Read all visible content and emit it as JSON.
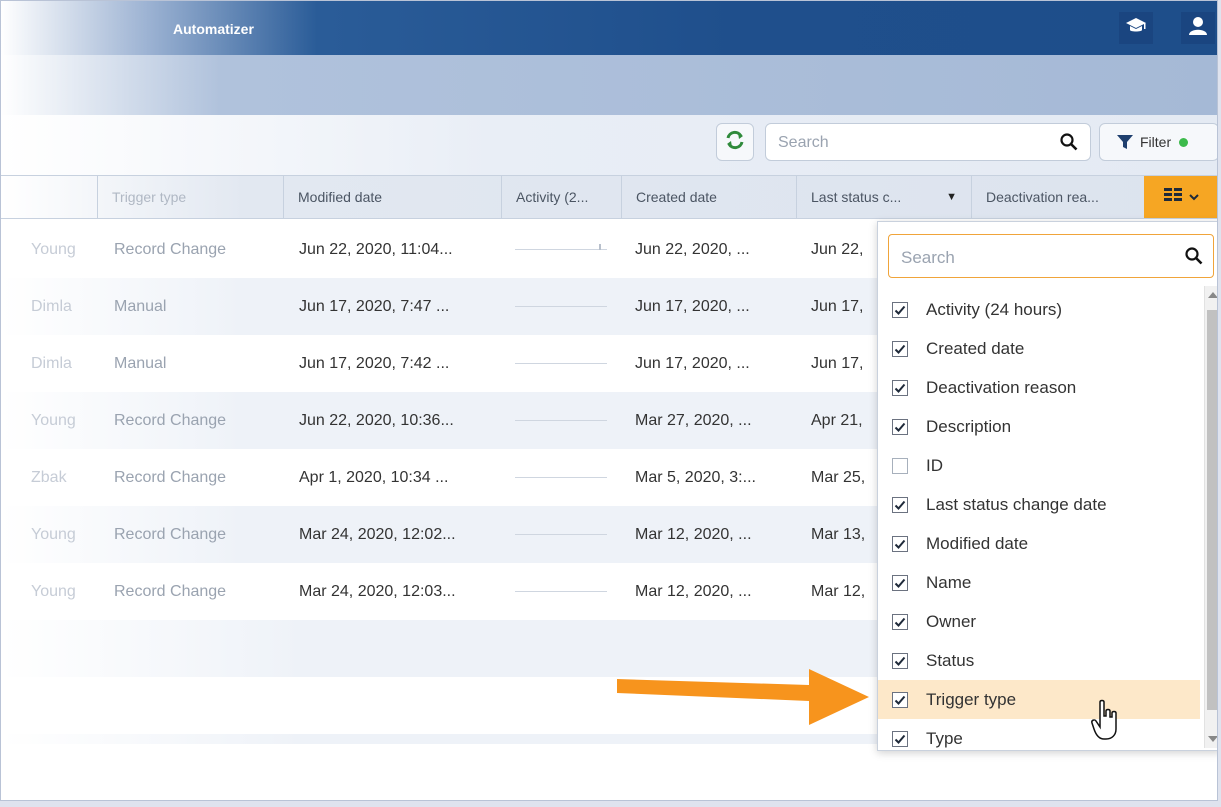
{
  "app": {
    "title": "Automatizer"
  },
  "toolbar": {
    "search_placeholder": "Search",
    "filter_label": "Filter",
    "filter_status_color": "#3cba4b"
  },
  "colors": {
    "header_blue": "#1f4f8c",
    "accent_orange": "#f6a623",
    "highlight": "#fde8c9"
  },
  "table": {
    "headers": {
      "trigger_type": "Trigger type",
      "modified_date": "Modified date",
      "activity": "Activity (2...",
      "created_date": "Created date",
      "last_status": "Last status c...",
      "deactivation": "Deactivation rea..."
    },
    "rows": [
      {
        "owner": "Young",
        "trigger": "Record Change",
        "modified": "Jun 22, 2020, 11:04...",
        "created": "Jun 22, 2020, ...",
        "last": "Jun 22,"
      },
      {
        "owner": "Dimla",
        "trigger": "Manual",
        "modified": "Jun 17, 2020, 7:47 ...",
        "created": "Jun 17, 2020, ...",
        "last": "Jun 17,"
      },
      {
        "owner": "Dimla",
        "trigger": "Manual",
        "modified": "Jun 17, 2020, 7:42 ...",
        "created": "Jun 17, 2020, ...",
        "last": "Jun 17,"
      },
      {
        "owner": "Young",
        "trigger": "Record Change",
        "modified": "Jun 22, 2020, 10:36...",
        "created": "Mar 27, 2020, ...",
        "last": "Apr 21,"
      },
      {
        "owner": "Zbak",
        "trigger": "Record Change",
        "modified": "Apr 1, 2020, 10:34 ...",
        "created": "Mar 5, 2020, 3:...",
        "last": "Mar 25,"
      },
      {
        "owner": "Young",
        "trigger": "Record Change",
        "modified": "Mar 24, 2020, 12:02...",
        "created": "Mar 12, 2020, ...",
        "last": "Mar 13,"
      },
      {
        "owner": "Young",
        "trigger": "Record Change",
        "modified": "Mar 24, 2020, 12:03...",
        "created": "Mar 12, 2020, ...",
        "last": "Mar 12,"
      }
    ]
  },
  "column_picker": {
    "search_placeholder": "Search",
    "items": [
      {
        "label": "Activity (24 hours)",
        "checked": true
      },
      {
        "label": "Created date",
        "checked": true
      },
      {
        "label": "Deactivation reason",
        "checked": true
      },
      {
        "label": "Description",
        "checked": true
      },
      {
        "label": "ID",
        "checked": false
      },
      {
        "label": "Last status change date",
        "checked": true
      },
      {
        "label": "Modified date",
        "checked": true
      },
      {
        "label": "Name",
        "checked": true
      },
      {
        "label": "Owner",
        "checked": true
      },
      {
        "label": "Status",
        "checked": true
      },
      {
        "label": "Trigger type",
        "checked": true,
        "highlighted": true
      },
      {
        "label": "Type",
        "checked": true
      }
    ]
  }
}
